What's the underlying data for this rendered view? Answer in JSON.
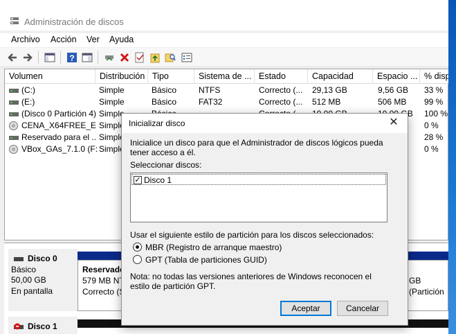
{
  "window": {
    "title": "Administración de discos"
  },
  "menu": [
    "Archivo",
    "Acción",
    "Ver",
    "Ayuda"
  ],
  "columns": [
    "Volumen",
    "Distribución",
    "Tipo",
    "Sistema de ...",
    "Estado",
    "Capacidad",
    "Espacio ...",
    "% dispon"
  ],
  "rows": [
    [
      "(C:)",
      "Simple",
      "Básico",
      "NTFS",
      "Correcto (...",
      "29,13 GB",
      "9,56 GB",
      "33 %"
    ],
    [
      "(E:)",
      "Simple",
      "Básico",
      "FAT32",
      "Correcto (...",
      "512 MB",
      "506 MB",
      "99 %"
    ],
    [
      "(Disco 0 Partición 4)",
      "Simple",
      "Básico",
      "",
      "Correcto (...",
      "10,00 GB",
      "10,00 GB",
      "100 %"
    ],
    [
      "CENA_X64FREE_ES...",
      "Simple",
      "",
      "",
      "",
      "",
      "",
      "0 %"
    ],
    [
      "Reservado para el ...",
      "Simple",
      "",
      "",
      "",
      "",
      "",
      "28 %"
    ],
    [
      "VBox_GAs_7.1.0 (F:)",
      "Simple",
      "",
      "",
      "",
      "",
      "",
      "0 %"
    ]
  ],
  "disk0": {
    "name": "Disco 0",
    "type": "Básico",
    "size": "50,00 GB",
    "status": "En pantalla",
    "partition_name": "Reservado",
    "partition_size": "579 MB NT",
    "partition_status": "Correcto (S",
    "right_size": "GB",
    "right_status": "(Partición"
  },
  "disk1": {
    "name": "Disco 1"
  },
  "dialog": {
    "title": "Inicializar disco",
    "intro": "Inicialice un disco para que el Administrador de discos lógicos pueda tener acceso a él.",
    "select_label": "Seleccionar discos:",
    "disk_item": "Disco 1",
    "style_label": "Usar el siguiente estilo de partición para los discos seleccionados:",
    "mbr_label": "MBR (Registro de arranque maestro)",
    "gpt_label": "GPT (Tabla de particiones GUID)",
    "note": "Nota: no todas las versiones anteriores de Windows reconocen el estilo de partición GPT.",
    "ok": "Aceptar",
    "cancel": "Cancelar"
  },
  "colors": {
    "accent": "#0078d7",
    "partition_header": "#0a2a8a"
  }
}
